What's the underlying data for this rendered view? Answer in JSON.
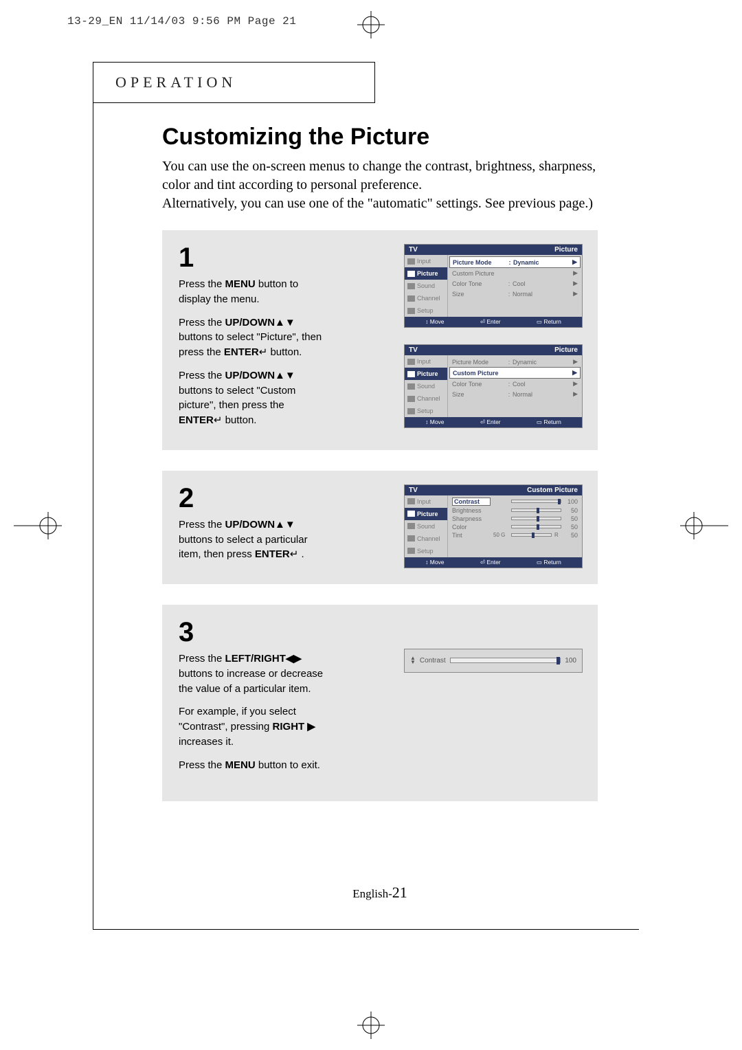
{
  "header_text": "13-29_EN  11/14/03 9:56 PM  Page 21",
  "section_label": "OPERATION",
  "title": "Customizing the Picture",
  "intro_line1": "You can use the on-screen menus to change the contrast, brightness, sharpness, color and tint according to personal preference.",
  "intro_line2": "Alternatively, you can use one of the \"automatic\" settings. See previous page.)",
  "step1": {
    "num": "1",
    "p1a": "Press the ",
    "p1b": "MENU",
    "p1c": " button to display the menu.",
    "p2a": "Press the ",
    "p2b": "UP/DOWN",
    "p2c": " buttons to select \"Picture\", then press the ",
    "p2d": "ENTER",
    "p2e": " button.",
    "p3a": "Press the ",
    "p3b": "UP/DOWN",
    "p3c": " buttons to select \"Custom picture\", then press the ",
    "p3d": "ENTER",
    "p3e": " button."
  },
  "step2": {
    "num": "2",
    "p1a": "Press the ",
    "p1b": "UP/DOWN",
    "p1c": " buttons to select a particular item, then press ",
    "p1d": "ENTER",
    "p1e": " ."
  },
  "step3": {
    "num": "3",
    "p1a": "Press the ",
    "p1b": "LEFT/RIGHT",
    "p1c": " buttons to increase or decrease the value of a particular item.",
    "p2a": "For example, if you select \"Contrast\", pressing ",
    "p2b": "RIGHT",
    "p2c": " increases it.",
    "p3a": "Press the ",
    "p3b": "MENU",
    "p3c": " button to exit."
  },
  "osd_common": {
    "tv": "TV",
    "picture_title": "Picture",
    "custom_title": "Custom Picture",
    "side": [
      "Input",
      "Picture",
      "Sound",
      "Channel",
      "Setup"
    ],
    "picture_mode_lbl": "Picture Mode",
    "picture_mode_val": "Dynamic",
    "custom_picture_lbl": "Custom Picture",
    "color_tone_lbl": "Color Tone",
    "color_tone_val": "Cool",
    "size_lbl": "Size",
    "size_val": "Normal",
    "ftr_move": "Move",
    "ftr_enter": "Enter",
    "ftr_return": "Return"
  },
  "chart_data": {
    "type": "table",
    "title": "Custom Picture",
    "items": [
      {
        "name": "Contrast",
        "value": 100,
        "extra_left": "",
        "extra_right": ""
      },
      {
        "name": "Brightness",
        "value": 50,
        "extra_left": "",
        "extra_right": ""
      },
      {
        "name": "Sharpness",
        "value": 50,
        "extra_left": "",
        "extra_right": ""
      },
      {
        "name": "Color",
        "value": 50,
        "extra_left": "",
        "extra_right": ""
      },
      {
        "name": "Tint",
        "value": 50,
        "extra_left": "G",
        "extra_right": "R",
        "left_num": 50
      }
    ]
  },
  "contrast_bar": {
    "label": "Contrast",
    "value": "100"
  },
  "footer_lang": "English-",
  "footer_page": "21",
  "glyphs": {
    "updown": "▲▼",
    "leftright": "◀▶",
    "right": "▶",
    "enter": "↵",
    "arrow_r": "▶",
    "move_icon": "↕",
    "enter_icon": "⏎",
    "return_icon": "▭"
  }
}
